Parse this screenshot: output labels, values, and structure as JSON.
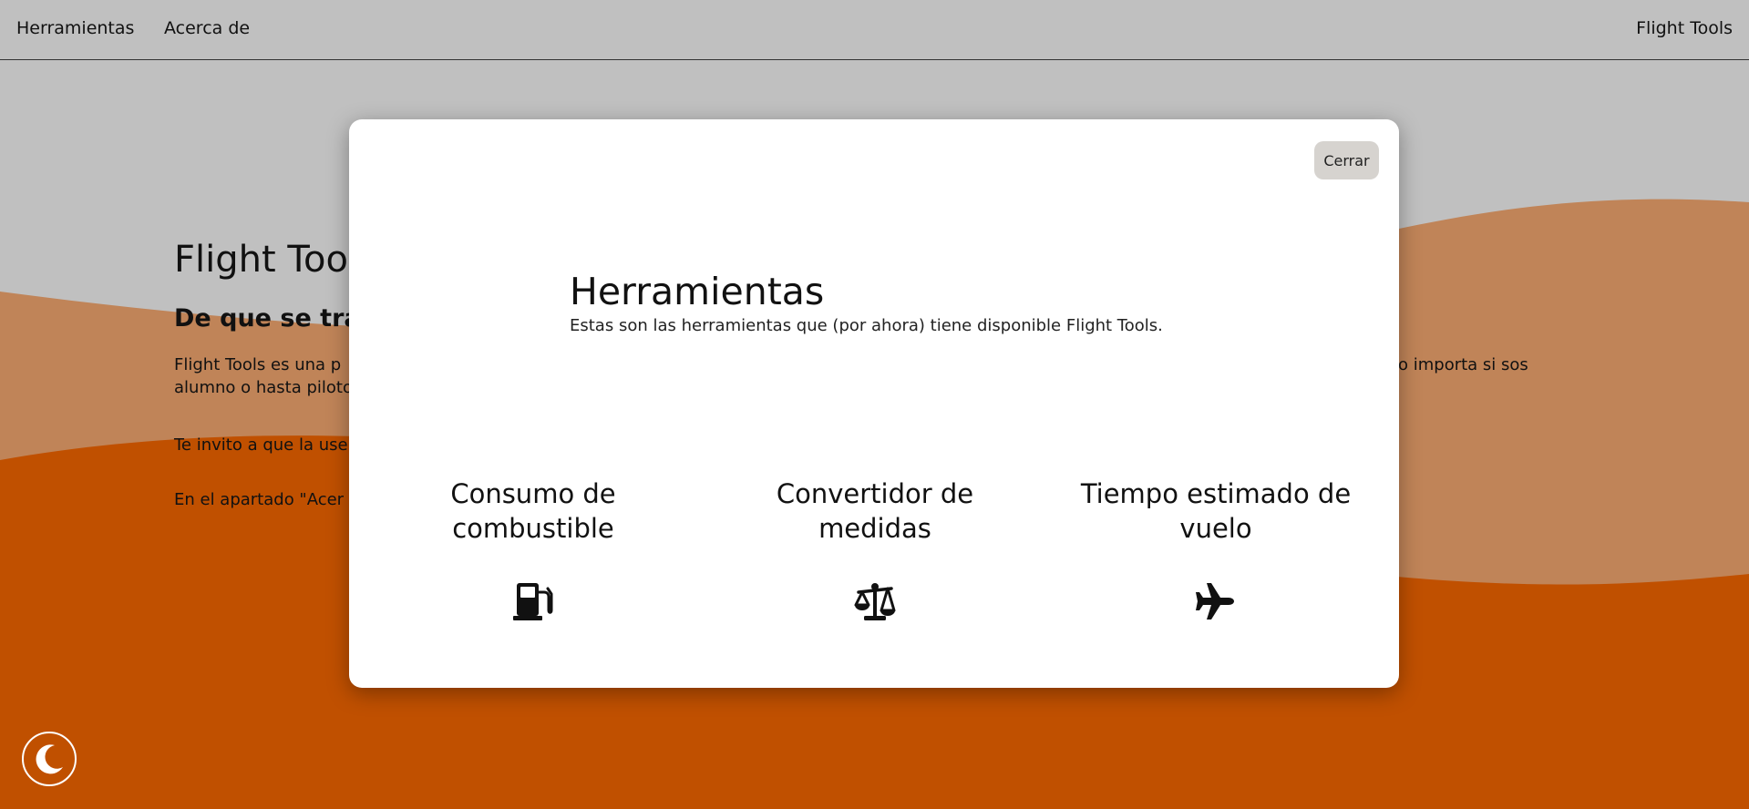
{
  "navbar": {
    "tools_label": "Herramientas",
    "about_label": "Acerca de",
    "brand": "Flight Tools"
  },
  "page": {
    "title": "Flight Tools",
    "subtitle": "De que se trata",
    "para1_left": "Flight Tools es una p",
    "para1_right": "lo importa si sos",
    "para1_line2": "alumno o hasta piloto",
    "para2": "Te invito a que la use",
    "para3": "En el apartado \"Acer"
  },
  "modal": {
    "close_label": "Cerrar",
    "title": "Herramientas",
    "description": "Estas son las herramientas que (por ahora) tiene disponible Flight Tools.",
    "tools": [
      {
        "name": "Consumo de combustible",
        "icon": "fuel-pump-icon"
      },
      {
        "name": "Convertidor de medidas",
        "icon": "scale-icon"
      },
      {
        "name": "Tiempo estimado de vuelo",
        "icon": "airplane-icon"
      }
    ]
  },
  "theme_toggle": {
    "icon": "moon-icon"
  },
  "colors": {
    "nav_bg": "#c0c0c0",
    "wave_light": "#c08458",
    "wave_dark": "#c05000",
    "modal_bg": "#ffffff",
    "close_bg": "#d6d3cf"
  }
}
